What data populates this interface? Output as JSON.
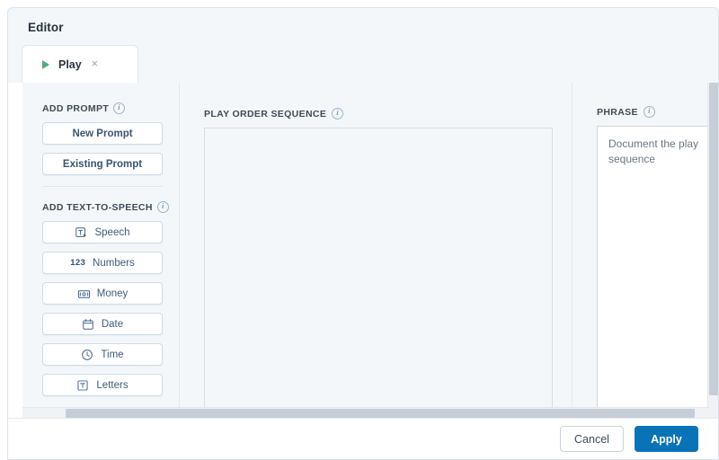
{
  "dialog": {
    "title": "Editor"
  },
  "tabs": [
    {
      "label": "Play",
      "icon": "play-triangle-icon",
      "close_label": "×",
      "active": true
    }
  ],
  "sidebar": {
    "sections": [
      {
        "id": "add-prompt",
        "title": "ADD PROMPT",
        "info_icon": "info-icon",
        "items": [
          {
            "label": "New Prompt",
            "icon": null
          },
          {
            "label": "Existing Prompt",
            "icon": null
          }
        ]
      },
      {
        "id": "add-text-to-speech",
        "title": "ADD TEXT-TO-SPEECH",
        "info_icon": "info-icon",
        "items": [
          {
            "label": "Speech",
            "icon": "text-speech-icon"
          },
          {
            "label": "Numbers",
            "icon": "numbers-123-icon"
          },
          {
            "label": "Money",
            "icon": "money-banknote-icon"
          },
          {
            "label": "Date",
            "icon": "calendar-icon"
          },
          {
            "label": "Time",
            "icon": "clock-icon"
          },
          {
            "label": "Letters",
            "icon": "letter-t-icon"
          }
        ]
      }
    ]
  },
  "center": {
    "title": "PLAY ORDER SEQUENCE",
    "info_icon": "info-icon",
    "dropzone_content": ""
  },
  "right": {
    "title": "PHRASE",
    "info_icon": "info-icon",
    "phrase_value": "Document the play sequence",
    "phrase_placeholder": "Document the play sequence"
  },
  "footer": {
    "cancel_label": "Cancel",
    "apply_label": "Apply"
  },
  "colors": {
    "accent": "#0a73b8",
    "panel_bg": "#f4f7fa",
    "play_icon": "#4caf7d",
    "border": "#dde3ea",
    "icon_blue": "#41638a"
  },
  "numbers_glyph": "123"
}
